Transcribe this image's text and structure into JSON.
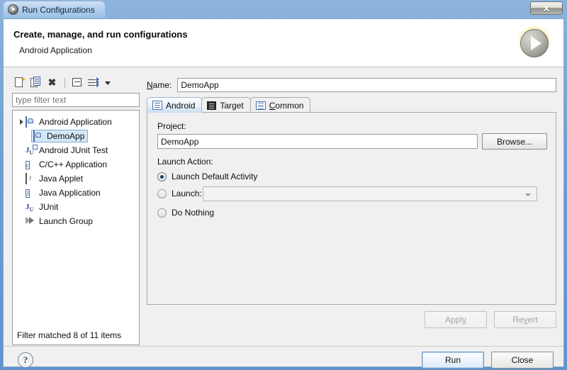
{
  "window": {
    "title": "Run Configurations",
    "title_icon": "run-circle-icon",
    "close_label": "✕"
  },
  "header": {
    "title": "Create, manage, and run configurations",
    "subtitle": "Android Application",
    "glyph": "run-sphere-icon"
  },
  "left_panel": {
    "toolbar": [
      {
        "name": "new-configuration-icon",
        "label": "New launch configuration"
      },
      {
        "name": "duplicate-configuration-icon",
        "label": "Duplicate"
      },
      {
        "name": "delete-configuration-icon",
        "label": "Delete"
      },
      {
        "name": "collapse-all-icon",
        "label": "Collapse All"
      },
      {
        "name": "filter-icon",
        "label": "Filter"
      },
      {
        "name": "chevron-down-icon",
        "label": "Menu"
      }
    ],
    "filter": {
      "value": "type filter text",
      "placeholder": "type filter text"
    },
    "tree": [
      {
        "label": "Android Application",
        "icon": "android-app-icon",
        "level": 0,
        "expanded": true,
        "selected": false
      },
      {
        "label": "DemoApp",
        "icon": "android-app-icon",
        "level": 1,
        "expanded": false,
        "selected": true
      },
      {
        "label": "Android JUnit Test",
        "icon": "android-junit-icon",
        "level": 0,
        "expanded": false,
        "selected": false
      },
      {
        "label": "C/C++ Application",
        "icon": "c-cpp-icon",
        "level": 0,
        "expanded": false,
        "selected": false
      },
      {
        "label": "Java Applet",
        "icon": "java-applet-icon",
        "level": 0,
        "expanded": false,
        "selected": false
      },
      {
        "label": "Java Application",
        "icon": "java-app-icon",
        "level": 0,
        "expanded": false,
        "selected": false
      },
      {
        "label": "JUnit",
        "icon": "junit-icon",
        "level": 0,
        "expanded": false,
        "selected": false
      },
      {
        "label": "Launch Group",
        "icon": "launch-group-icon",
        "level": 0,
        "expanded": false,
        "selected": false
      }
    ],
    "status": "Filter matched 8 of 11 items"
  },
  "right_panel": {
    "name_label_pre": "N",
    "name_label_post": "ame:",
    "name_value": "DemoApp",
    "tabs": [
      {
        "label": "Android",
        "icon": "android-tab-icon",
        "active": true,
        "mnemonic": ""
      },
      {
        "label": "Target",
        "icon": "target-tab-icon",
        "active": false,
        "mnemonic": ""
      },
      {
        "label": "Common",
        "icon": "common-tab-icon",
        "active": false,
        "mnemonic": "C"
      }
    ],
    "project_label": "Project:",
    "project_value": "DemoApp",
    "browse_label": "Browse...",
    "launch_action_label": "Launch Action:",
    "radios": [
      {
        "label": "Launch Default Activity",
        "checked": true
      },
      {
        "label": "Launch:",
        "checked": false
      },
      {
        "label": "Do Nothing",
        "checked": false
      }
    ],
    "launch_combo_value": "",
    "apply_label_pre": "Appl",
    "apply_label_mn": "y",
    "apply_label_post": "",
    "revert_label_pre": "Re",
    "revert_label_mn": "v",
    "revert_label_post": "ert",
    "apply_enabled": false,
    "revert_enabled": false
  },
  "footer": {
    "help_label": "?",
    "run_label": "Run",
    "close_label": "Close"
  },
  "colors": {
    "title_bar": "#6e9fd2",
    "dialog_bg": "#f0f0f0",
    "selection": "#d4e7f7",
    "accent": "#3b5fa8"
  }
}
